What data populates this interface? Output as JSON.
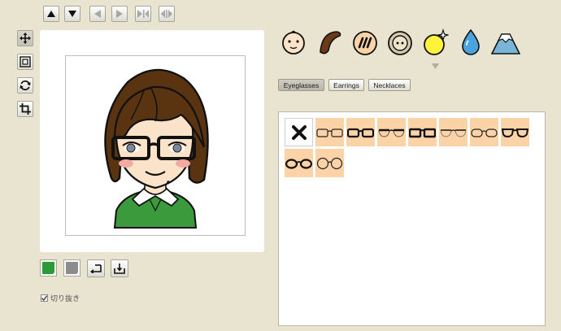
{
  "toolbar": {
    "nav_buttons": [
      "bring-forward",
      "send-backward",
      "previous",
      "next",
      "flip-horizontal",
      "swap"
    ],
    "tools": [
      "move",
      "scale",
      "rotate",
      "crop"
    ]
  },
  "avatar": {
    "hair_color": "#5a3311",
    "skin_color": "#fbe3c9",
    "shirt_color": "#3b9a3c",
    "cheek_color": "#f6a9a0"
  },
  "colors": {
    "primary": "#2c9a36",
    "secondary": "#8c8c8c"
  },
  "controls": {
    "undo_icon": "undo-icon",
    "save_icon": "download-icon"
  },
  "crop_option": {
    "label": "切り抜き",
    "checked": true
  },
  "categories": [
    "face",
    "hair",
    "eyebrows",
    "eyes",
    "accessories",
    "tears",
    "background"
  ],
  "selected_category": "accessories",
  "tabs": {
    "eyeglasses": "Eyeglasses",
    "earrings": "Earrings",
    "necklaces": "Necklaces",
    "active": "eyeglasses"
  },
  "items": [
    {
      "type": "none"
    },
    {
      "type": "glasses",
      "style": "thin-rect"
    },
    {
      "type": "glasses",
      "style": "thick-rect"
    },
    {
      "type": "glasses",
      "style": "browline"
    },
    {
      "type": "glasses",
      "style": "thick-rect-2"
    },
    {
      "type": "glasses",
      "style": "half-rim"
    },
    {
      "type": "glasses",
      "style": "rounded"
    },
    {
      "type": "glasses",
      "style": "bold-rim"
    },
    {
      "type": "glasses",
      "style": "oval"
    },
    {
      "type": "glasses",
      "style": "round"
    }
  ]
}
